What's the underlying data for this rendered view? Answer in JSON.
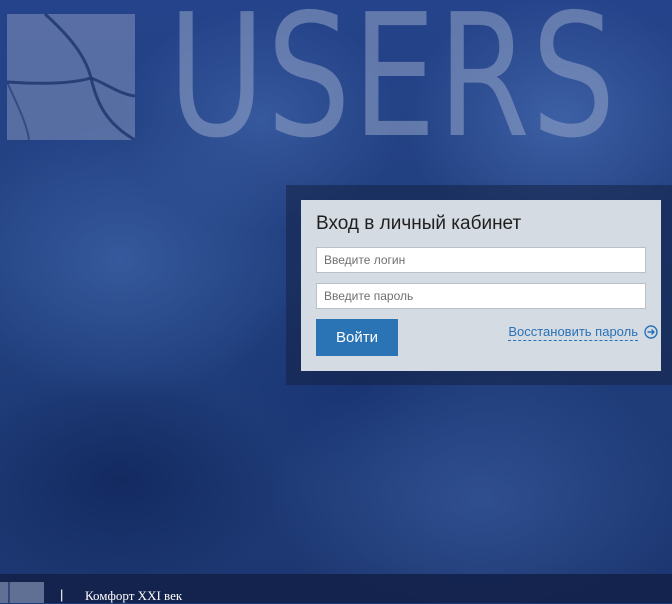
{
  "brand": {
    "logo_text": "USERS"
  },
  "login": {
    "title": "Вход в личный кабинет",
    "login_placeholder": "Введите логин",
    "password_placeholder": "Введите пароль",
    "submit_label": "Войти",
    "recover_label": "Восстановить пароль",
    "recover_icon": "arrow-right-circle-icon"
  },
  "footer": {
    "divider": "|",
    "company": "Комфорт XXI век"
  },
  "colors": {
    "background": "#21407f",
    "panel": "#d5dbe2",
    "button": "#2a74b5",
    "link": "#2a72b8"
  }
}
